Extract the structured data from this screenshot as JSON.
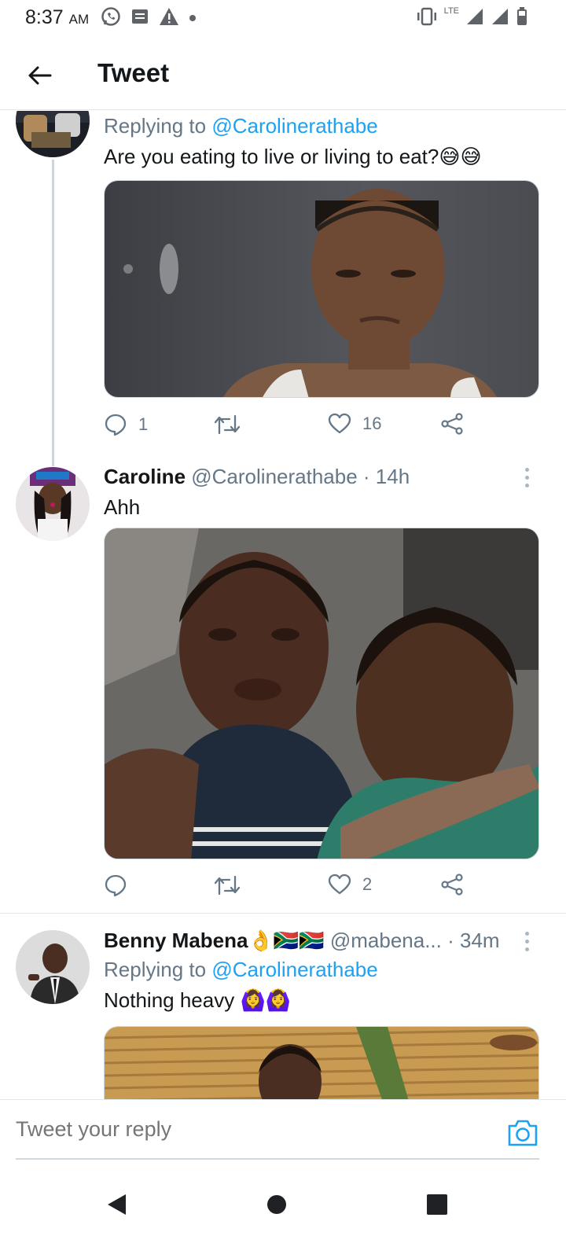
{
  "status_bar": {
    "time": "8:37",
    "ampm": "AM",
    "network": "LTE",
    "icons": [
      "whatsapp-icon",
      "message-icon",
      "alert-icon",
      "dot-icon",
      "vibrate-icon",
      "signal-icon",
      "signal-icon",
      "battery-icon"
    ]
  },
  "header": {
    "title": "Tweet",
    "back_icon": "arrow-left-icon"
  },
  "tweets": [
    {
      "replying_label": "Replying to",
      "replying_handle": "@Carolinerathabe",
      "text": "Are you eating to live or living to eat?😅😅",
      "media": "photo of a woman with a skeptical expression",
      "reply_count": "1",
      "retweet_count": "",
      "like_count": "16"
    },
    {
      "name": "Caroline",
      "handle": "@Carolinerathabe",
      "time": "· 14h",
      "text": "Ahh",
      "media": "photo of two crying boys being held",
      "reply_count": "",
      "retweet_count": "",
      "like_count": "2"
    },
    {
      "name": "Benny Mabena",
      "name_emoji": "👌🇿🇦🇿🇦",
      "handle": "@mabena...",
      "time": "· 34m",
      "replying_label": "Replying to",
      "replying_handle": "@Carolinerathabe",
      "text": "Nothing heavy 🙆‍♀️🙆‍♀️",
      "media": "photo of a boy on a straw mat"
    }
  ],
  "reply_bar": {
    "placeholder": "Tweet your reply",
    "camera_icon": "camera-icon"
  },
  "nav_bar": {
    "icons": [
      "back-triangle-icon",
      "home-circle-icon",
      "recents-square-icon"
    ]
  },
  "colors": {
    "accent": "#1da1f2",
    "secondary_text": "#657786",
    "primary_text": "#14171a",
    "divider": "#e1e8ed"
  }
}
